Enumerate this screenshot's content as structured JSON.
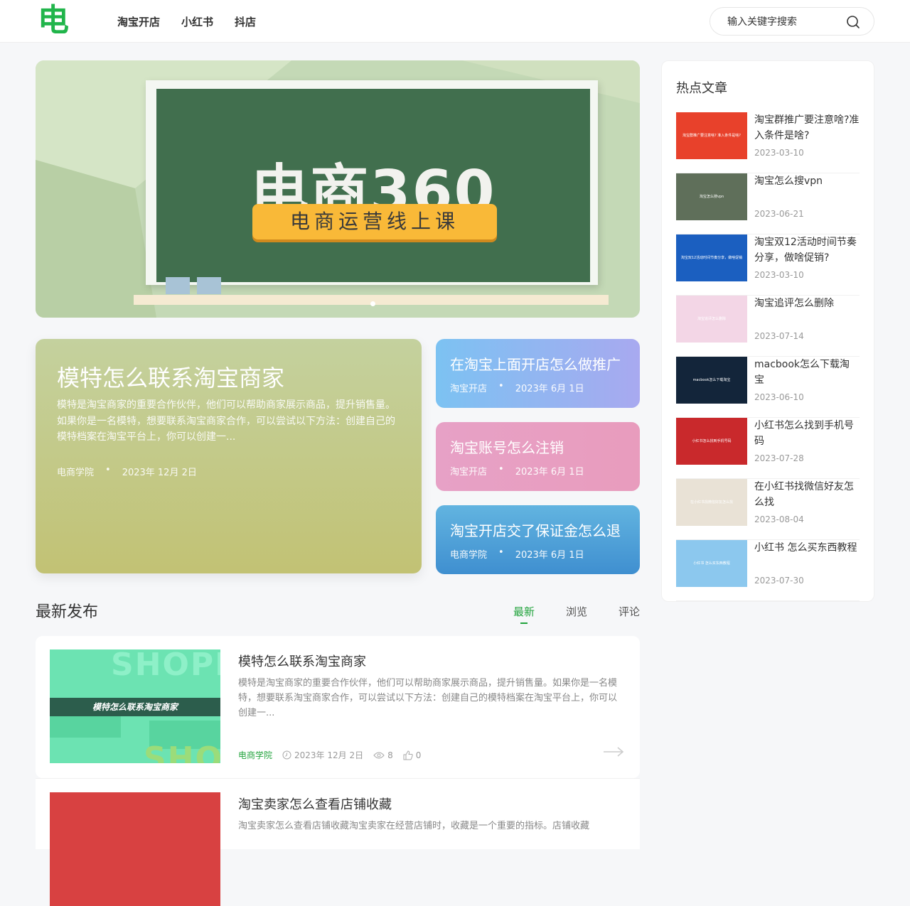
{
  "header": {
    "logo_char": "电",
    "nav": [
      "淘宝开店",
      "小红书",
      "抖店"
    ],
    "search_placeholder": "输入关键字搜索",
    "accent": "#21b54b"
  },
  "banner": {
    "title": "电商360",
    "subtitle": "电商运营线上课"
  },
  "featured": {
    "main": {
      "title": "模特怎么联系淘宝商家",
      "excerpt": "模特是淘宝商家的重要合作伙伴，他们可以帮助商家展示商品，提升销售量。如果你是一名模特，想要联系淘宝商家合作，可以尝试以下方法：创建自己的模特档案在淘宝平台上，你可以创建一...",
      "category": "电商学院",
      "dot": "•",
      "date": "2023年 12月 2日"
    },
    "cards": [
      {
        "title": "在淘宝上面开店怎么做推广",
        "category": "淘宝开店",
        "dot": "•",
        "date": "2023年 6月 1日"
      },
      {
        "title": "淘宝账号怎么注销",
        "category": "淘宝开店",
        "dot": "•",
        "date": "2023年 6月 1日"
      },
      {
        "title": "淘宝开店交了保证金怎么退",
        "category": "电商学院",
        "dot": "•",
        "date": "2023年 6月 1日"
      }
    ]
  },
  "latest": {
    "title": "最新发布",
    "tabs": [
      "最新",
      "浏览",
      "评论"
    ],
    "posts": [
      {
        "thumb_band": "模特怎么联系淘宝商家",
        "thumb_top": "SHOPP",
        "thumb_bottom": "SHOP",
        "title": "模特怎么联系淘宝商家",
        "excerpt": "模特是淘宝商家的重要合作伙伴，他们可以帮助商家展示商品，提升销售量。如果你是一名模特，想要联系淘宝商家合作，可以尝试以下方法：创建自己的模特档案在淘宝平台上，你可以创建一...",
        "category": "电商学院",
        "date": "2023年 12月 2日",
        "views": "8",
        "likes": "0"
      },
      {
        "title": "淘宝卖家怎么查看店铺收藏",
        "excerpt": "淘宝卖家怎么查看店铺收藏淘宝卖家在经营店铺时，收藏是一个重要的指标。店铺收藏"
      }
    ]
  },
  "sidebar": {
    "title": "热点文章",
    "items": [
      {
        "title": "淘宝群推广要注意啥?准入条件是啥?",
        "date": "2023-03-10",
        "thumb": "淘宝群推广要注意啥? 准入条件是啥?",
        "color": "#e8412b"
      },
      {
        "title": "淘宝怎么搜vpn",
        "date": "2023-06-21",
        "thumb": "淘宝怎么搜vpn",
        "color": "#5f6f5a"
      },
      {
        "title": "淘宝双12活动时间节奏分享，做啥促销?",
        "date": "2023-03-10",
        "thumb": "淘宝双12活动时间节奏分享，做啥促销",
        "color": "#1b5fc0"
      },
      {
        "title": "淘宝追评怎么删除",
        "date": "2023-07-14",
        "thumb": "淘宝追评怎么删除",
        "color": "#f3d6e6"
      },
      {
        "title": "macbook怎么下载淘宝",
        "date": "2023-06-10",
        "thumb": "macbook怎么下载淘宝",
        "color": "#13253a"
      },
      {
        "title": "小红书怎么找到手机号码",
        "date": "2023-07-28",
        "thumb": "小红书怎么找到手机号码",
        "color": "#c9292c"
      },
      {
        "title": "在小红书找微信好友怎么找",
        "date": "2023-08-04",
        "thumb": "在小红书找微信好友怎么找",
        "color": "#e9e2d6"
      },
      {
        "title": "小红书 怎么买东西教程",
        "date": "2023-07-30",
        "thumb": "小红书 怎么买东西教程",
        "color": "#8cc8ee"
      }
    ]
  }
}
